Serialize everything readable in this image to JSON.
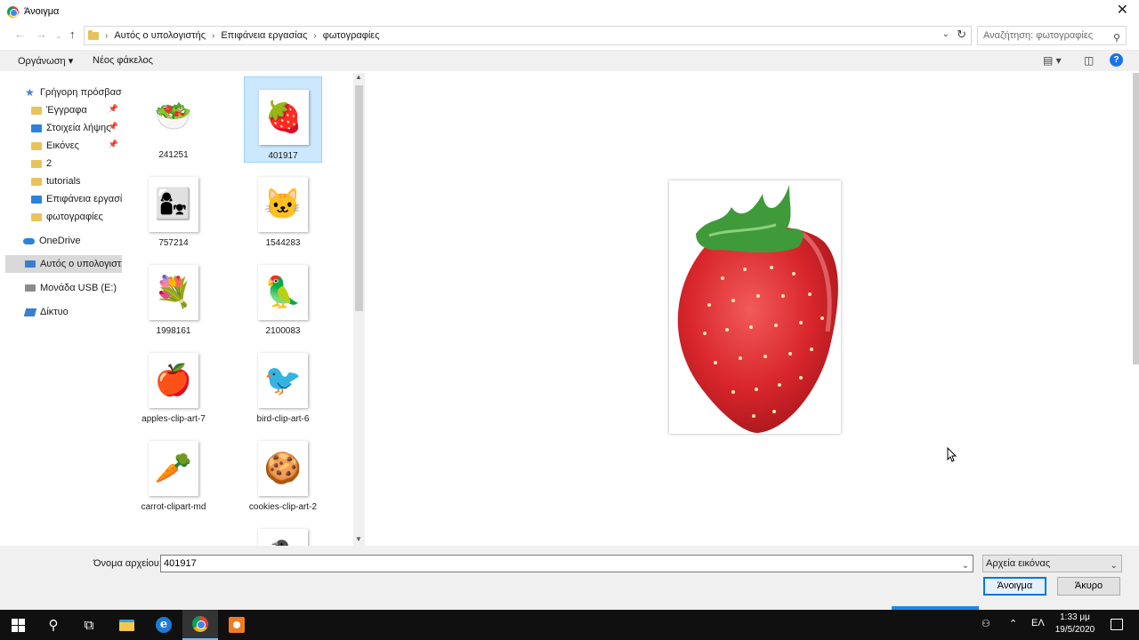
{
  "window": {
    "title": "Άνοιγμα"
  },
  "address": {
    "crumbs": [
      "Αυτός ο υπολογιστής",
      "Επιφάνεια εργασίας",
      "φωτογραφίες"
    ],
    "search_placeholder": "Αναζήτηση: φωτογραφίες"
  },
  "toolbar": {
    "organize": "Οργάνωση",
    "new_folder": "Νέος φάκελος"
  },
  "sidebar": {
    "items": [
      {
        "label": "Γρήγορη πρόσβαση"
      },
      {
        "label": "Έγγραφα"
      },
      {
        "label": "Στοιχεία λήψης"
      },
      {
        "label": "Εικόνες"
      },
      {
        "label": "2"
      },
      {
        "label": "tutorials"
      },
      {
        "label": "Επιφάνεια εργασίας"
      },
      {
        "label": "φωτογραφίες"
      },
      {
        "label": "OneDrive"
      },
      {
        "label": "Αυτός ο υπολογιστής"
      },
      {
        "label": "Μονάδα USB (E:)"
      },
      {
        "label": "Δίκτυο"
      }
    ]
  },
  "files": [
    {
      "name": "241251",
      "icon": "🥗"
    },
    {
      "name": "401917",
      "icon": "🍓"
    },
    {
      "name": "757214",
      "icon": "👩‍👧"
    },
    {
      "name": "1544283",
      "icon": "🐱"
    },
    {
      "name": "1998161",
      "icon": "💐"
    },
    {
      "name": "2100083",
      "icon": "🦜"
    },
    {
      "name": "apples-clip-art-7",
      "icon": "🍎"
    },
    {
      "name": "bird-clip-art-6",
      "icon": "🐦"
    },
    {
      "name": "carrot-clipart-md",
      "icon": "🥕"
    },
    {
      "name": "cookies-clip-art-2",
      "icon": "🍪"
    },
    {
      "name": "",
      "icon": "🐧"
    }
  ],
  "bottom": {
    "filename_label": "Όνομα αρχείου:",
    "filename_value": "401917",
    "filetype": "Αρχεία εικόνας",
    "open_label": "Άνοιγμα",
    "cancel_label": "Άκυρο"
  },
  "taskbar": {
    "lang": "ΕΛ",
    "time": "1:33 μμ",
    "date": "19/5/2020"
  },
  "colors": {
    "selection": "#cce8ff",
    "accent": "#0078d7",
    "strawberry": "#d8262c"
  }
}
